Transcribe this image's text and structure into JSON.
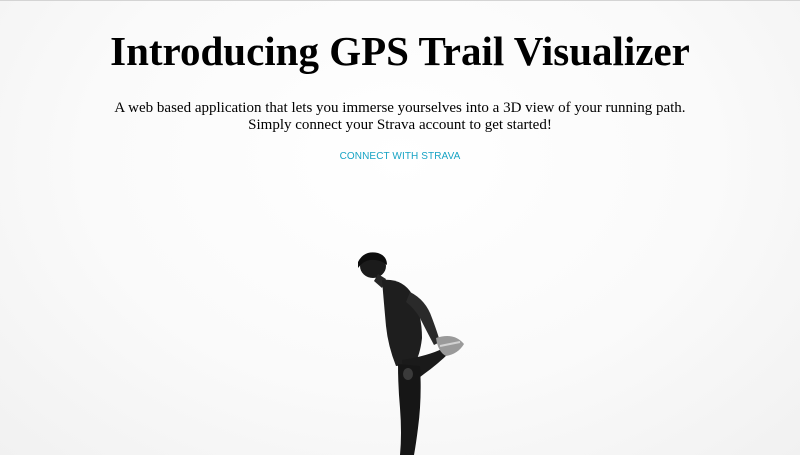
{
  "hero": {
    "title": "Introducing GPS Trail Visualizer",
    "description_line1": "A web based application that lets you immerse yourselves into a 3D view of your running path.",
    "description_line2": "Simply connect your Strava account to get started!",
    "cta_label": "CONNECT WITH STRAVA"
  },
  "colors": {
    "accent": "#16a3c4",
    "text": "#000000",
    "background": "#f7f7f7"
  },
  "images": {
    "background_photo": "runner-stretching-photo"
  }
}
